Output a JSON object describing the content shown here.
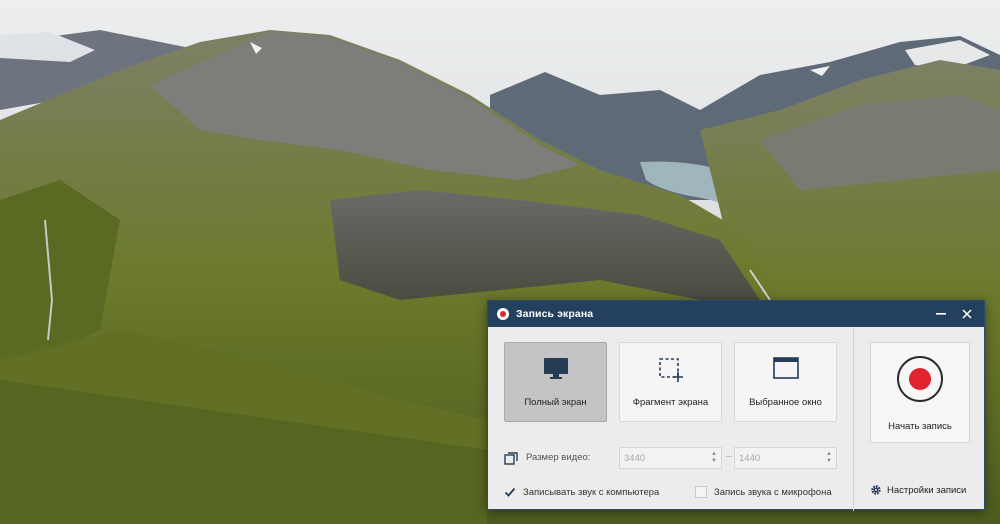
{
  "desktop": {
    "wallpaper": "mountain-landscape"
  },
  "window": {
    "title": "Запись экрана",
    "minimize_icon": "minimize-icon",
    "close_icon": "close-icon"
  },
  "modes": [
    {
      "label": "Полный экран",
      "icon": "monitor-icon",
      "selected": true
    },
    {
      "label": "Фрагмент экрана",
      "icon": "region-select-icon",
      "selected": false
    },
    {
      "label": "Выбранное окно",
      "icon": "window-icon",
      "selected": false
    }
  ],
  "video_size": {
    "label": "Размер видео:",
    "width": "3440",
    "height": "1440",
    "separator": "–"
  },
  "audio": {
    "computer": {
      "label": "Записывать звук с компьютера",
      "checked": true
    },
    "microphone": {
      "label": "Запись звука с микрофона",
      "checked": false
    }
  },
  "start": {
    "label": "Начать запись"
  },
  "settings": {
    "label": "Настройки записи"
  },
  "colors": {
    "titlebar": "#23405e",
    "record_red": "#e0232e",
    "panel_bg": "#ececec",
    "selected_mode": "#c4c4c4"
  }
}
